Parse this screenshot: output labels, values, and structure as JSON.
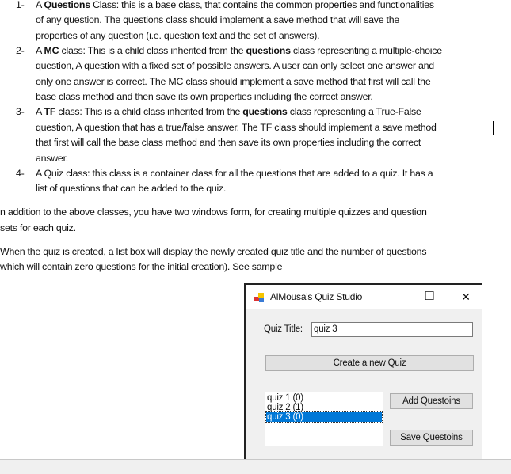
{
  "document": {
    "items": [
      {
        "number": "1-",
        "lines": [
          [
            {
              "t": "A "
            },
            {
              "t": "Questions",
              "b": true
            },
            {
              "t": " Class: this is a base class, that contains the common properties and functionalities"
            }
          ],
          [
            {
              "t": "of any question. The questions class should implement a save method that will save the"
            }
          ],
          [
            {
              "t": "properties of any question (i.e. question text and the set of answers)."
            }
          ]
        ]
      },
      {
        "number": "2-",
        "lines": [
          [
            {
              "t": "A "
            },
            {
              "t": "MC",
              "b": true
            },
            {
              "t": " class: This is a child class inherited from the "
            },
            {
              "t": "questions",
              "b": true
            },
            {
              "t": " class representing a multiple-choice"
            }
          ],
          [
            {
              "t": "question, A question with a fixed set of possible answers. A user can only select one answer and"
            }
          ],
          [
            {
              "t": "only one answer is correct. The MC class should implement a save method that first will call the"
            }
          ],
          [
            {
              "t": "base class method and then save its own properties including the correct answer."
            }
          ]
        ]
      },
      {
        "number": "3-",
        "lines": [
          [
            {
              "t": "A "
            },
            {
              "t": "TF",
              "b": true
            },
            {
              "t": " class: This is a child class inherited from the "
            },
            {
              "t": "questions",
              "b": true
            },
            {
              "t": " class representing a True-False"
            }
          ],
          [
            {
              "t": "question, A question that has a true/false answer. The TF class should implement a save method"
            }
          ],
          [
            {
              "t": "that first will call the base class method and then save its own properties including the correct"
            }
          ],
          [
            {
              "t": "answer."
            }
          ]
        ]
      },
      {
        "number": "4-",
        "lines": [
          [
            {
              "t": "A Quiz class: this class is a container class for all the questions that are added to a quiz. It has a"
            }
          ],
          [
            {
              "t": "list of questions that can be added to the quiz."
            }
          ]
        ]
      }
    ],
    "paragraphs": [
      [
        "n addition to the above classes, you have two windows form, for creating multiple quizzes and question",
        "sets for each quiz."
      ],
      [
        "When the quiz is created, a list box will display the newly created quiz title and the number of questions",
        "which will contain zero questions for the initial creation). See sample"
      ]
    ]
  },
  "window": {
    "title": "AlMousa's Quiz Studio",
    "minimize": "—",
    "maximize": "☐",
    "close": "✕",
    "quiz_title_label": "Quiz Title:",
    "quiz_title_value": "quiz 3",
    "create_button": "Create a new Quiz",
    "add_button": "Add Questoins",
    "save_button": "Save Questoins",
    "quizzes": [
      {
        "label": "quiz 1 (0)",
        "selected": false
      },
      {
        "label": "quiz 2 (1)",
        "selected": false
      },
      {
        "label": "quiz 3 (0)",
        "selected": true
      }
    ],
    "selection_color": "#0078d7"
  }
}
